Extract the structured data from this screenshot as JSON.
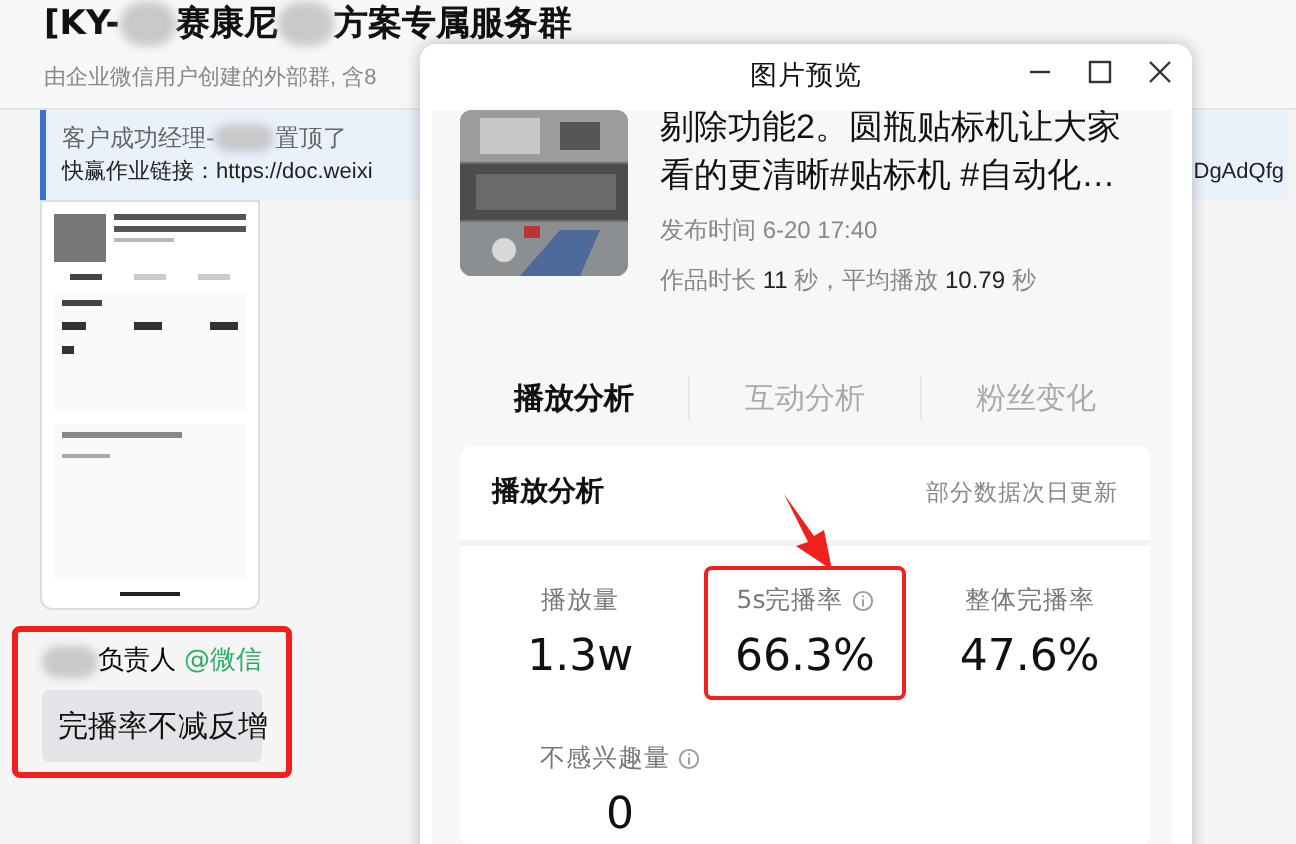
{
  "chat": {
    "title": [
      {
        "kind": "text",
        "text": "[KY-"
      },
      {
        "kind": "redacted"
      },
      {
        "kind": "text",
        "text": "赛康尼"
      },
      {
        "kind": "redacted"
      },
      {
        "kind": "text",
        "text": "方案专属服务群"
      }
    ],
    "subtitle": "由企业微信用户创建的外部群, 含8",
    "pinned": {
      "line1": [
        {
          "kind": "text",
          "text": "客户成功经理-"
        },
        {
          "kind": "redacted"
        },
        {
          "kind": "text",
          "text": "置顶了"
        }
      ],
      "line2": "快赢作业链接：https://doc.weixi",
      "tail": "DgAdQfg"
    },
    "message": {
      "sender": [
        {
          "kind": "redacted"
        },
        {
          "kind": "text",
          "text": "负责人"
        }
      ],
      "source": "@微信",
      "text": "完播率不减反增",
      "highlighted": true
    }
  },
  "preview": {
    "title": "图片预览",
    "video": {
      "title": "剔除功能2。圆瓶贴标机让大家看的更清晰#贴标机 #自动化…",
      "published": "发布时间 6-20 17:40",
      "stats": "作品时长 **11** 秒，平均播放 **10.79** 秒"
    },
    "tabs": [
      {
        "label": "播放分析",
        "selected": true
      },
      {
        "label": "互动分析",
        "selected": false
      },
      {
        "label": "粉丝变化",
        "selected": false
      }
    ],
    "card": {
      "title": "播放分析",
      "note": "部分数据次日更新",
      "metrics": [
        {
          "label": "播放量",
          "value": "1.3w",
          "info": false,
          "highlighted": false
        },
        {
          "label": "5s完播率",
          "value": "66.3%",
          "info": true,
          "highlighted": true
        },
        {
          "label": "整体完播率",
          "value": "47.6%",
          "info": false,
          "highlighted": false
        },
        {
          "label": "不感兴趣量",
          "value": "0",
          "info": true,
          "highlighted": false
        }
      ]
    }
  }
}
